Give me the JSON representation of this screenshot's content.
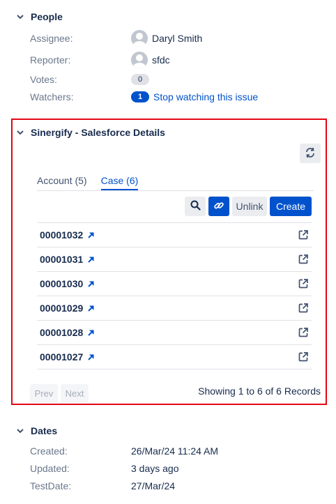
{
  "people": {
    "title": "People",
    "assignee_label": "Assignee:",
    "assignee_value": "Daryl Smith",
    "reporter_label": "Reporter:",
    "reporter_value": "sfdc",
    "votes_label": "Votes:",
    "votes_value": "0",
    "watchers_label": "Watchers:",
    "watchers_count": "1",
    "watchers_link": "Stop watching this issue"
  },
  "salesforce": {
    "title": "Sinergify - Salesforce Details",
    "tabs": [
      {
        "label": "Account (5)",
        "active": false
      },
      {
        "label": "Case (6)",
        "active": true
      }
    ],
    "unlink_label": "Unlink",
    "create_label": "Create",
    "records": [
      "00001032",
      "00001031",
      "00001030",
      "00001029",
      "00001028",
      "00001027"
    ],
    "prev_label": "Prev",
    "next_label": "Next",
    "showing_text": "Showing 1 to 6 of 6 Records"
  },
  "dates": {
    "title": "Dates",
    "created_label": "Created:",
    "created_value": "26/Mar/24 11:24 AM",
    "updated_label": "Updated:",
    "updated_value": "3 days ago",
    "testdate_label": "TestDate:",
    "testdate_value": "27/Mar/24"
  },
  "colors": {
    "highlight_border": "#e30613",
    "primary": "#0052cc",
    "muted_text": "#6b778c"
  }
}
